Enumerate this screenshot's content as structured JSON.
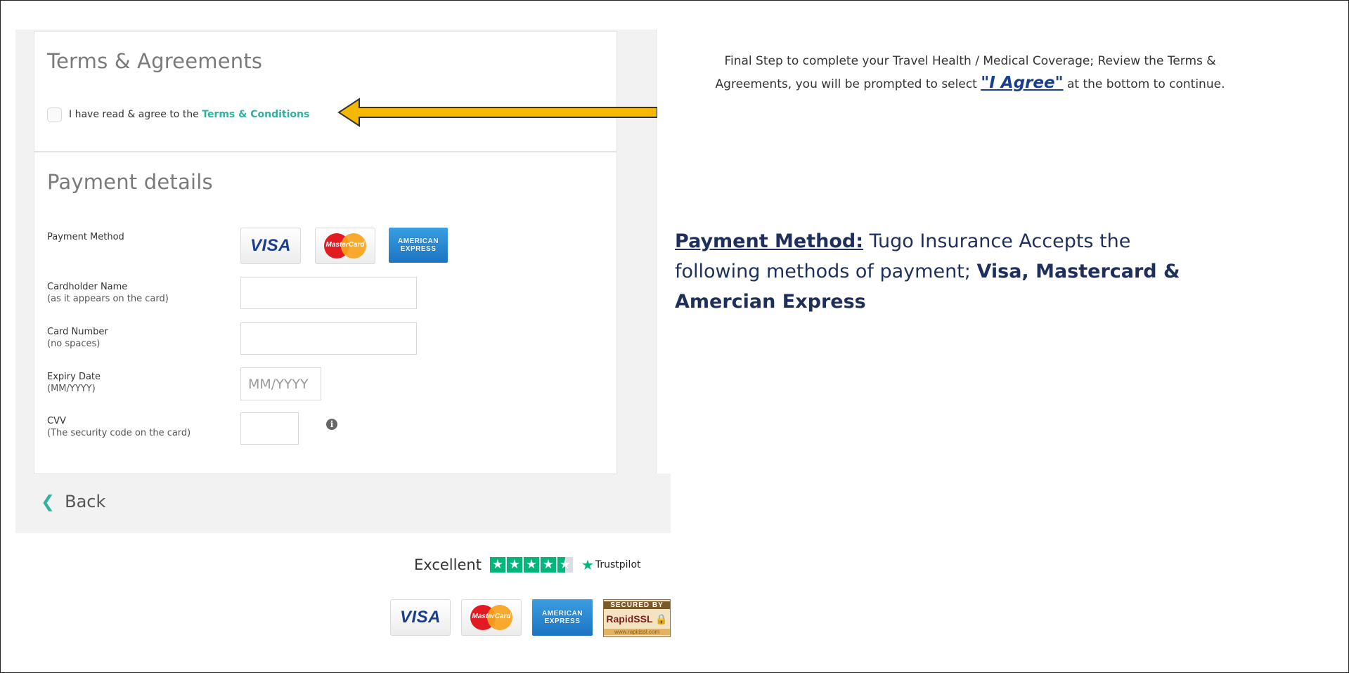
{
  "terms": {
    "heading": "Terms & Agreements",
    "agree_prefix": "I have read & agree to the ",
    "agree_link": "Terms & Conditions"
  },
  "payment": {
    "heading": "Payment details",
    "method_label": "Payment Method",
    "cards": [
      "VISA",
      "MasterCard",
      "AMERICAN EXPRESS"
    ],
    "cardholder_label": "Cardholder Name",
    "cardholder_sub": "(as it appears on the card)",
    "card_number_label": "Card Number",
    "card_number_sub": "(no spaces)",
    "expiry_label": "Expiry Date",
    "expiry_sub": "(MM/YYYY)",
    "expiry_placeholder": "MM/YYYY",
    "cvv_label": "CVV",
    "cvv_sub": "(The security code on the card)",
    "info_icon": "i"
  },
  "back_label": "Back",
  "trustpilot": {
    "rating_text": "Excellent",
    "stars": 4.5,
    "brand": "Trustpilot"
  },
  "footer_logos": {
    "visa": "VISA",
    "mastercard": "MasterCard",
    "amex_line1": "AMERICAN",
    "amex_line2": "EXPRESS",
    "ssl_top": "SECURED BY",
    "ssl_mid": "RapidSSL",
    "ssl_bottom": "www.rapidssl.com"
  },
  "annotation_terms": {
    "line1": "Final Step to complete your Travel Health / Medical Coverage; Review the Terms &",
    "line2_prefix": "Agreements, you will be prompted to select ",
    "line2_highlight": "\"I Agree\"",
    "line2_suffix": " at the bottom to continue."
  },
  "annotation_payment": {
    "heading": "Payment Method:",
    "text1": " Tugo Insurance Accepts the following methods of payment; ",
    "bold": "Visa, Mastercard & Amercian Express"
  },
  "colors": {
    "accent_teal": "#2fb3a0",
    "arrow_fill": "#f5b800",
    "annotation_navy": "#1f2f5c"
  }
}
